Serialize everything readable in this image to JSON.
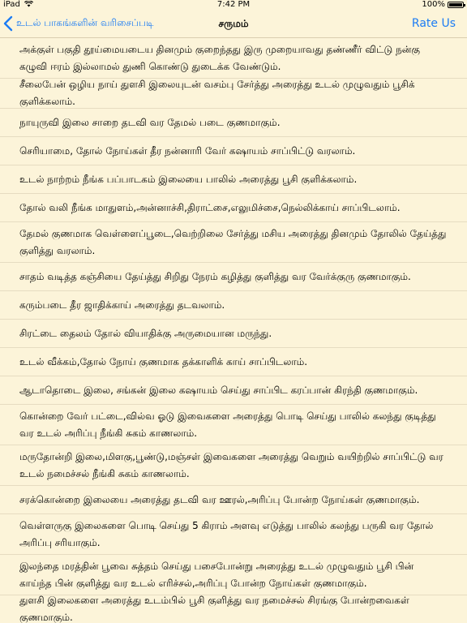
{
  "status_bar": {
    "carrier": "iPad",
    "wifi_icon": "wifi-icon",
    "time": "7:42 PM",
    "battery_percent": "100%",
    "battery_level": 1.0
  },
  "nav": {
    "back_label": "உடல் பாகங்களின் வரிசைப்படி",
    "title": "சருமம்",
    "rate_label": "Rate Us",
    "accent_color": "#1c7cf4"
  },
  "items": [
    "அக்குள் பகுதி தூய்மையடைய தினமும் குறைந்தது இரு முறையாவது தண்ணீர் விட்டு நன்கு கழுவி ஈரம் இல்லாமல் துணி கொண்டு துடைக்க வேண்டும்.",
    "சீலைபேன் ஒழிய நாய் துளசி இலையுடன் வசம்பு சேர்த்து அரைத்து உடல் முழுவதும் பூசிக் குளிக்கலாம்.",
    "நாயுருவி இலை சாறை தடவி வர தேமல் படை குணமாகும்.",
    "செரியாமை, தோல் நோய்கள் தீர நன்னாரி வேர் கஷாயம் சாப்பிட்டு வரலாம்.",
    "உடல் நாற்றம் நீங்க பப்பாடகம் இலையை பாலில் அரைத்து பூசி குளிக்கலாம்.",
    "தோல் வலி நீங்க மாதுளம்,அன்னாச்சி,திராட்சை,எலுமிச்சை,நெல்லிக்காய் சாப்பிடலாம்.",
    "தேமல் குணமாக வெள்ளைப்பூடை,வெற்றிலை சேர்த்து மசிய அரைத்து தினமும் தோலில் தேய்த்து குளித்து வரலாம்.",
    "சாதம் வடித்த கஞ்சியை தேய்த்து சிறிது நேரம் கழித்து குளித்து வர வேர்க்குரு குணமாகும்.",
    "கரும்படை தீர ஜாதிக்காய் அரைத்து தடவலாம்.",
    "சிரட்டை தைலம் தோல் வியாதிக்கு அருமையான மருந்து.",
    "உடல் வீக்கம்,தோல் நோய் குணமாக தக்காளிக் காய் சாப்பிடலாம்.",
    "ஆடாதொடை இலை, சங்கன் இலை கஷாயம் செய்து சாப்பிட கரப்பான் கிரந்தி குணமாகும்.",
    "கொன்றை வேர் பட்டை,வில்வ ஓடு இவைகளை அரைத்து பொடி செய்து பாலில் கலந்து குடித்து வர உடல் அரிப்பு நீங்கி சுகம் காணலாம்.",
    "மருதோன்றி இலை,மிளகு,பூண்டு,மஞ்சள் இவைகளை அரைத்து வெறும் வயிற்றில் சாப்பிட்டு வர உடல் நமைச்சல் நீங்கி சுகம் காணலாம்.",
    "சரக்கொன்றை இலையை அரைத்து தடவி வர ஊரல்,அரிப்பு போன்ற நோய்கள் குணமாகும்.",
    "வெள்ளருகு இலைகளை பொடி செய்து 5 கிராம் அளவு எடுத்து பாலில் கலந்து பருகி வர தோல் அரிப்பு சரியாகும்.",
    "இலந்தை மரத்தின் பூவை சுத்தம் செய்து பசைபோன்று அரைத்து உடல் முழுவதும் பூசி பின் காய்ந்த பின் குளித்து வர உடல் எரிச்சல்,அரிப்பு போன்ற நோய்கள் குணமாகும்.",
    "துளசி இலைகளை அரைத்து உடம்பில் பூசி குளித்து வர நமைச்சல் சிரங்கு போன்றவைகள் குணமாகும்."
  ]
}
